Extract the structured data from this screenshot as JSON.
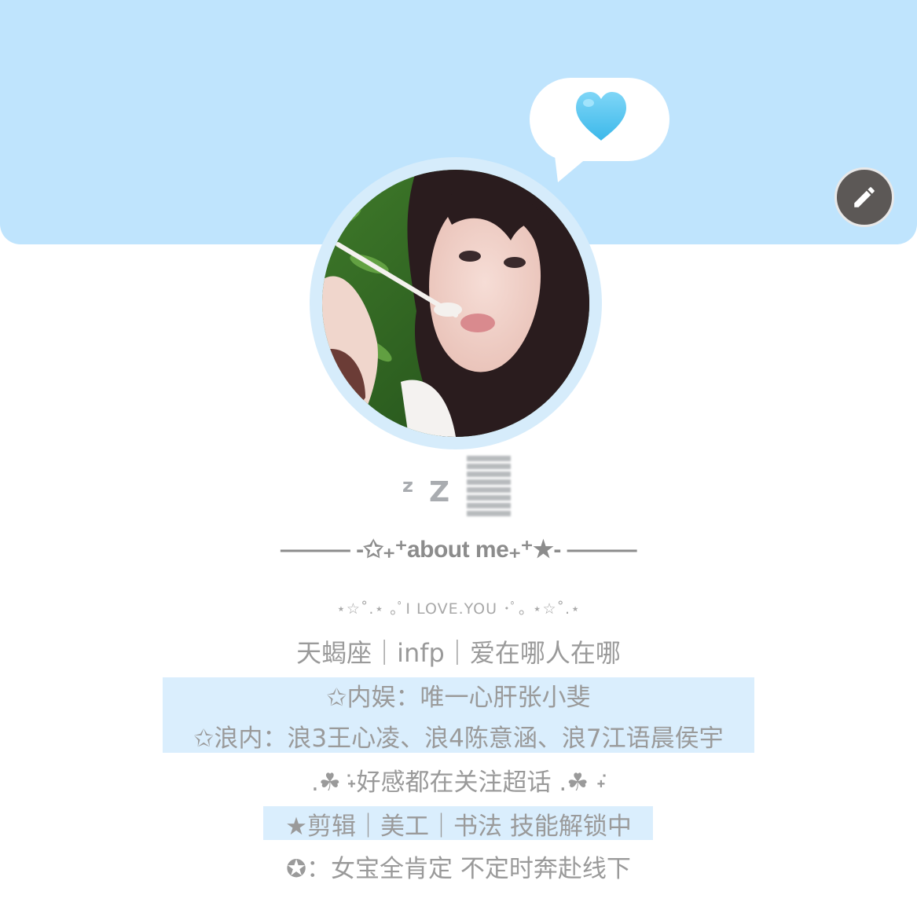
{
  "banner": {
    "color": "#bfe4fd",
    "bubble_icon": "blue-heart-icon",
    "edit_icon": "pencil-icon"
  },
  "profile": {
    "avatar": "profile-photo",
    "name_prefix_small": "z",
    "name_prefix_large": "Z"
  },
  "bio": {
    "section_title": "——— -✩₊⁺about me₊⁺★-  ———",
    "decoration": "⋆☆˚.⋆ ｡ﾟI LOVE.YOU ･ﾟ｡ ⋆☆˚.⋆",
    "line1": "天蝎座｜infp｜爱在哪人在哪",
    "line2": "✩内娱：唯一心肝张小斐",
    "line3": "✩浪内：浪3王心凌、浪4陈意涵、浪7江语晨侯宇",
    "line4": ".☘︎ ݁˖好感都在关注超话 .☘︎ ݁˖",
    "line5": "★剪辑｜美工｜书法 技能解锁中",
    "line6": "✪：女宝全肯定 不定时奔赴线下"
  },
  "colors": {
    "banner": "#bfe4fd",
    "highlight": "#daeefd",
    "text": "#9a9a9a",
    "edit_button": "#5c5856"
  }
}
